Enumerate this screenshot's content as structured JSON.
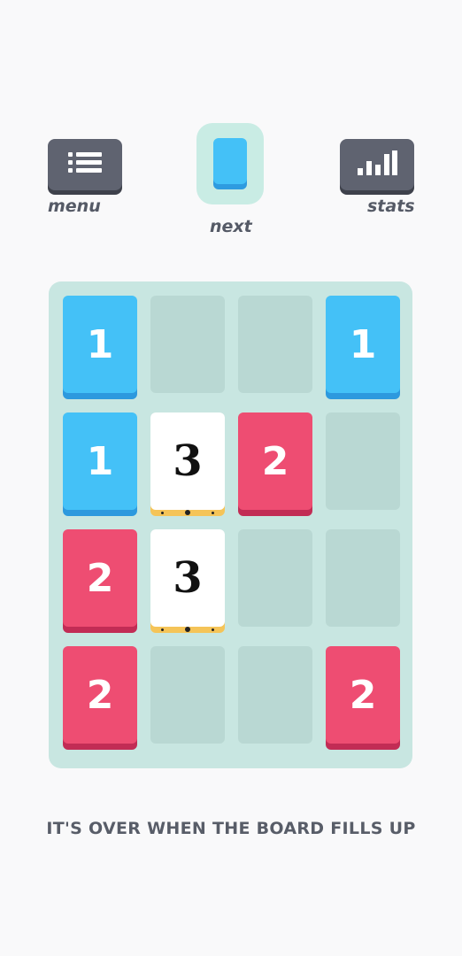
{
  "header": {
    "menu_label": "menu",
    "next_label": "next",
    "stats_label": "stats",
    "menu_icon": "list-icon",
    "stats_icon": "bar-chart-icon"
  },
  "next_card": {
    "color": "blue",
    "hex": "#44c1f7"
  },
  "board": {
    "rows": 4,
    "cols": 4,
    "tiles": [
      {
        "row": 0,
        "col": 0,
        "value": "1",
        "color": "blue"
      },
      {
        "row": 0,
        "col": 3,
        "value": "1",
        "color": "blue"
      },
      {
        "row": 1,
        "col": 0,
        "value": "1",
        "color": "blue"
      },
      {
        "row": 1,
        "col": 1,
        "value": "3",
        "color": "white"
      },
      {
        "row": 1,
        "col": 2,
        "value": "2",
        "color": "red"
      },
      {
        "row": 2,
        "col": 0,
        "value": "2",
        "color": "red"
      },
      {
        "row": 2,
        "col": 1,
        "value": "3",
        "color": "white"
      },
      {
        "row": 3,
        "col": 0,
        "value": "2",
        "color": "red"
      },
      {
        "row": 3,
        "col": 3,
        "value": "2",
        "color": "red"
      }
    ]
  },
  "colors": {
    "blue": "#44c1f7",
    "red": "#ee4d72",
    "white": "#ffffff",
    "board": "#c8e6e1",
    "button": "#5f6370"
  },
  "tagline": "IT'S OVER WHEN THE BOARD FILLS UP"
}
